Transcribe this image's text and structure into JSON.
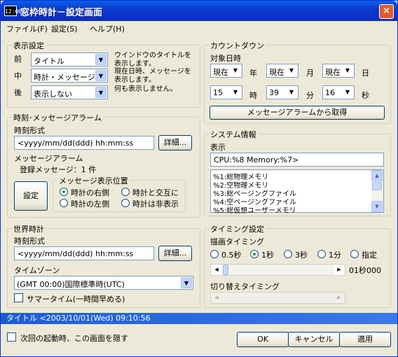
{
  "window": {
    "icon_text": "12:00",
    "title": "窓枠時計－設定画面",
    "close": "✕"
  },
  "menubar": {
    "file": "ファイル(F)",
    "settings": "設定(S)",
    "help": "ヘルプ(H)"
  },
  "display": {
    "group": "表示設定",
    "front_label": "前",
    "middle_label": "中",
    "back_label": "後",
    "front_value": "タイトル",
    "middle_value": "時計・メッセージ",
    "back_value": "表示しない",
    "desc1": "ウインドウのタイトルを表示します。",
    "desc2": "現在日時、メッセージを表示します。",
    "desc3": "何も表示しません。"
  },
  "alarm": {
    "group": "時刻･メッセージアラーム",
    "format_label": "時刻形式",
    "format_value": "<yyyy/mm/dd(ddd) hh:mm:ss",
    "detail_btn": "詳細...",
    "msg_alarm_label": "メッセージアラーム",
    "registered": "登録メッセージ：1 件",
    "settings_btn": "設定",
    "position_group": "メッセージ表示位置",
    "pos_right": "時計の右側",
    "pos_alternate": "時計と交互に",
    "pos_left": "時計の左側",
    "pos_hidden": "時計は非表示"
  },
  "world": {
    "group": "世界時計",
    "format_label": "時刻形式",
    "format_value": "<yyyy/mm/dd(ddd) hh:mm:ss",
    "detail_btn": "詳細...",
    "tz_label": "タイムゾーン",
    "tz_value": "(GMT 00:00)国際標準時(UTC)",
    "summer": "サマータイム(一時間早める)"
  },
  "countdown": {
    "group": "カウントダウン",
    "target_label": "対象日時",
    "year_value": "現在",
    "year_unit": "年",
    "month_value": "現在",
    "month_unit": "月",
    "day_value": "現在",
    "day_unit": "日",
    "hour_value": "15",
    "hour_unit": "時",
    "minute_value": "39",
    "minute_unit": "分",
    "second_value": "16",
    "second_unit": "秒",
    "fetch_btn": "メッセージアラームから取得"
  },
  "sysinfo": {
    "group": "システム情報",
    "display_label": "表示",
    "display_value": "CPU:%8 Memory:%7>",
    "items": [
      "%1:総物理メモリ",
      "%2:空物理メモリ",
      "%3:総ページングファイル",
      "%4:空ページングファイル",
      "%5:総仮想ユーザーメモリ"
    ]
  },
  "timing": {
    "group": "タイミング設定",
    "draw_label": "描画タイミング",
    "opt1": "0.5秒",
    "opt2": "1秒",
    "opt3": "3秒",
    "opt4": "1分",
    "opt5": "指定",
    "slider_value": "01秒000",
    "switch_label": "切り替えタイミング"
  },
  "status": {
    "text": "タイトル <2003/10/01(Wed) 09:10:56"
  },
  "footer": {
    "hide_startup": "次回の起動時、この画面を隠す",
    "ok": "OK",
    "cancel": "キャンセル",
    "apply": "適用"
  }
}
